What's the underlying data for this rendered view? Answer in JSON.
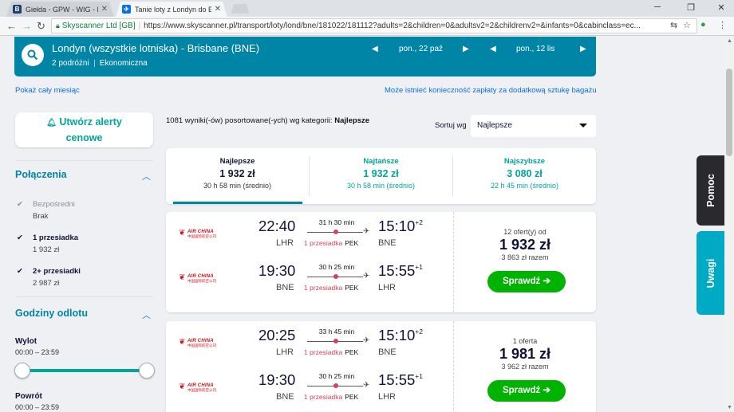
{
  "browser": {
    "tabs": [
      {
        "title": "Giełda - GPW - WIG - No",
        "favicon": "B",
        "active": false
      },
      {
        "title": "Tanie loty z Londyn do B",
        "favicon": "✈",
        "active": true
      }
    ],
    "secure_label": "Skyscanner Ltd [GB]",
    "url": "https://www.skyscanner.pl/transport/loty/lond/bne/181022/181112?adults=2&children=0&adultsv2=2&childrenv2=&infants=0&cabinclass=ec..."
  },
  "search": {
    "route": "Londyn (wszystkie lotniska) - Brisbane (BNE)",
    "travellers": "2 podróżni",
    "cabin": "Ekonomiczna",
    "depart_date": "pon., 22 paź",
    "return_date": "pon., 12 lis"
  },
  "links": {
    "month": "Pokaż cały miesiąc",
    "baggage": "Może istnieć konieczność zapłaty za dodatkową sztukę bagażu"
  },
  "sidebar": {
    "alert_line1": "Utwórz alerty",
    "alert_line2": "cenowe",
    "connections_title": "Połączenia",
    "stops": [
      {
        "label": "Bezpośredni",
        "sub": "Brak",
        "checked": true,
        "disabled": true
      },
      {
        "label": "1 przesiadka",
        "sub": "1 932 zł",
        "checked": true,
        "disabled": false
      },
      {
        "label": "2+ przesiadki",
        "sub": "2 987 zł",
        "checked": true,
        "disabled": false
      }
    ],
    "times_title": "Godziny odlotu",
    "outbound_label": "Wylot",
    "outbound_range": "00:00 – 23:59",
    "return_label": "Powrót",
    "return_range": "00:00 – 23:59"
  },
  "results": {
    "count_text": "1081 wyniki(-ów) posortowane(-ych) wg kategorii:",
    "count_sort": "Najlepsze",
    "sort_label": "Sortuj wg",
    "sort_value": "Najlepsze"
  },
  "sort_tabs": [
    {
      "title": "Najlepsze",
      "price": "1 932 zł",
      "duration": "30 h 58 min (średnio)"
    },
    {
      "title": "Najtańsze",
      "price": "1 932 zł",
      "duration": "30 h 58 min (średnio)"
    },
    {
      "title": "Najszybsze",
      "price": "3 080 zł",
      "duration": "22 h 45 min (średnio)"
    }
  ],
  "airline_name": "AIR CHINA",
  "airline_cn": "中国国际航空公司",
  "cards": [
    {
      "legs": [
        {
          "dep": "22:40",
          "dep_code": "LHR",
          "arr": "15:10",
          "arr_plus": "+2",
          "arr_code": "BNE",
          "duration": "31 h 30 min",
          "stops": "1 przesiadka",
          "via": "PEK"
        },
        {
          "dep": "19:30",
          "dep_code": "BNE",
          "arr": "15:55",
          "arr_plus": "+1",
          "arr_code": "LHR",
          "duration": "30 h 25 min",
          "stops": "1 przesiadka",
          "via": "PEK"
        }
      ],
      "offers": "12 ofert(y) od",
      "price": "1 932 zł",
      "total": "3 863 zł razem",
      "button": "Sprawdź ➔"
    },
    {
      "legs": [
        {
          "dep": "20:25",
          "dep_code": "LHR",
          "arr": "15:10",
          "arr_plus": "+2",
          "arr_code": "BNE",
          "duration": "33 h 45 min",
          "stops": "1 przesiadka",
          "via": "PEK"
        },
        {
          "dep": "19:30",
          "dep_code": "BNE",
          "arr": "15:55",
          "arr_plus": "+1",
          "arr_code": "LHR",
          "duration": "30 h 25 min",
          "stops": "1 przesiadka",
          "via": "PEK"
        }
      ],
      "offers": "1 oferta",
      "price": "1 981 zł",
      "total": "3 962 zł razem",
      "button": "Sprawdź ➔"
    }
  ],
  "side_tabs": {
    "help": "Pomoc",
    "feedback": "Uwagi"
  },
  "colors": {
    "brand": "#0085a6",
    "accent": "#00a698",
    "cta": "#00b300",
    "stop": "#d1435b"
  }
}
